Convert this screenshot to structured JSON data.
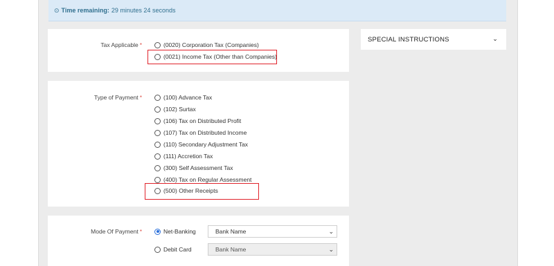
{
  "timer": {
    "icon": "clock-icon",
    "label": "Time remaining:",
    "value": "29 minutes 24 seconds"
  },
  "tax_applicable": {
    "label": "Tax Applicable",
    "required": "*",
    "options": [
      {
        "label": "(0020) Corporation Tax (Companies)",
        "checked": false
      },
      {
        "label": "(0021) Income Tax (Other than Companies)",
        "checked": false,
        "highlighted": true
      }
    ]
  },
  "type_of_payment": {
    "label": "Type of Payment",
    "required": "*",
    "options": [
      {
        "label": "(100) Advance Tax"
      },
      {
        "label": "(102) Surtax"
      },
      {
        "label": "(106) Tax on Distributed Profit"
      },
      {
        "label": "(107) Tax on Distributed Income"
      },
      {
        "label": "(110) Secondary Adjustment Tax"
      },
      {
        "label": "(111) Accretion Tax"
      },
      {
        "label": "(300) Self Assessment Tax"
      },
      {
        "label": "(400) Tax on Regular Assessment"
      },
      {
        "label": "(500) Other Receipts",
        "highlighted": true
      }
    ]
  },
  "mode_of_payment": {
    "label": "Mode Of Payment",
    "required": "*",
    "options": [
      {
        "label": "Net-Banking",
        "checked": true,
        "select_value": "Bank Name"
      },
      {
        "label": "Debit Card",
        "checked": false,
        "select_value": "Bank Name",
        "disabled": true
      }
    ]
  },
  "special_instructions": {
    "label": "SPECIAL INSTRUCTIONS",
    "icon": "chevron-down-icon"
  },
  "colors": {
    "highlight": "#e0222a",
    "timer_bg": "#dbeaf7",
    "accent": "#2a6fdb"
  }
}
